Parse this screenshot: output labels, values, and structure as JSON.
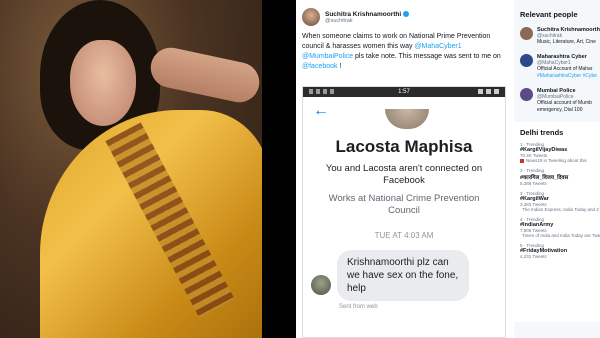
{
  "tweet": {
    "name": "Suchitra Krishnamoorthi",
    "handle": "@suchitrak",
    "text_1": "When someone claims to work on National Prime Prevention council & harasses women this way ",
    "mention_1": "@MahaCyber1",
    "text_2": " ",
    "mention_2": "@MumbaiPolice",
    "text_3": " pls take note. This message was sent to me on ",
    "mention_3": "@facebook",
    "text_4": " !"
  },
  "phone": {
    "time": "1:57",
    "back_glyph": "←",
    "profile_name": "Lacosta Maphisa",
    "connection": "You and Lacosta aren't connected on Facebook",
    "work": "Works at National Crime Prevention Council",
    "timestamp": "TUE AT 4:03 AM",
    "message": "Krishnamoorthi plz can we have sex on the fone, help",
    "sent_from": "Sent from web"
  },
  "sidebar": {
    "title": "Relevant people",
    "people": [
      {
        "name": "Suchitra Krishnamoorth",
        "handle": "@suchitrak",
        "bio": "Music, Literature, Art, Cine",
        "avatar_color": "#8a6a55"
      },
      {
        "name": "Maharashtra Cyber",
        "handle": "@MahaCyber1",
        "bio": "Official Account of Mahar",
        "bio_link": "#MaharashtraCyber #Cybe",
        "avatar_color": "#2c4a8a"
      },
      {
        "name": "Mumbai Police",
        "handle": "@MumbaiPolice",
        "bio": "Official account of Mumb",
        "bio_2": "emergency, Dial 100",
        "avatar_color": "#5a4a8a"
      }
    ],
    "trends_title": "Delhi trends",
    "trends": [
      {
        "rank": "1 · Trending",
        "tag": "#KargilVijayDiwas",
        "count": "70.4K Tweets",
        "note": "News18 is Tweeting about this"
      },
      {
        "rank": "2 · Trending",
        "tag": "#कारगिल_विजय_दिवस",
        "count": "5,268 Tweets",
        "note": ""
      },
      {
        "rank": "3 · Trending",
        "tag": "#KargilWar",
        "count": "3,383 Tweets",
        "note": "The Indian Express, India Today and 2 more are Tweeting about this"
      },
      {
        "rank": "4 · Trending",
        "tag": "#IndianArmy",
        "count": "7,906 Tweets",
        "note": "Times of India and India Today are Tweeting about this"
      },
      {
        "rank": "5 · Trending",
        "tag": "#FridayMotivation",
        "count": "4,231 Tweets",
        "note": ""
      }
    ]
  }
}
